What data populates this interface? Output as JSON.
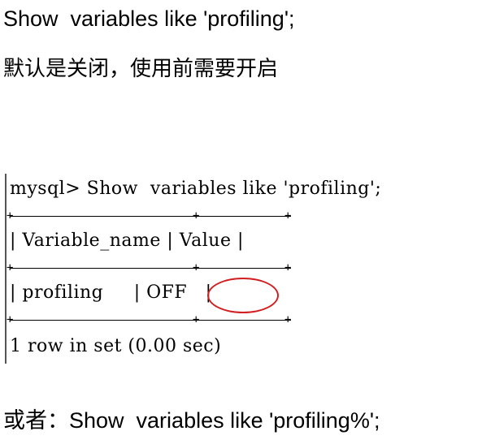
{
  "heading": "Show  variables like 'profiling';",
  "note": "默认是关闭，使用前需要开启",
  "console": {
    "command_line": "mysql> Show  variables like 'profiling';",
    "header_row": "| Variable_name | Value |",
    "data_row": "| profiling     | OFF   |",
    "result_line": "1 row in set (0.00 sec)",
    "highlight_color": "#d02020"
  },
  "footer": "或者：Show  variables like 'profiling%';"
}
